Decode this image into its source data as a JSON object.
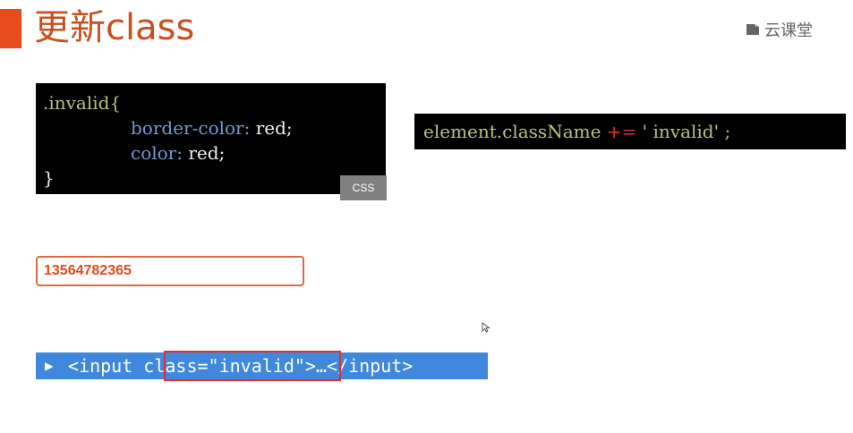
{
  "title": "更新class",
  "logo": {
    "text": "云课堂",
    "icon": "cloud-classroom-icon"
  },
  "css_code": {
    "lines": [
      {
        "selector": ".invalid{"
      },
      {
        "property": "border-color",
        "colon": ":",
        "value": " red;"
      },
      {
        "property": "color",
        "colon": ":",
        "value": " red;"
      },
      {
        "close": "}"
      }
    ],
    "tag": "CSS"
  },
  "js_code": {
    "object": "element.className",
    "operator": "+=",
    "string": "' invalid'",
    "end": " ;"
  },
  "input_demo": {
    "value": "13564782365"
  },
  "devtools": {
    "toggle": "▶",
    "before": "<input ",
    "attr": "class=\"invalid\"",
    "after": ">…</input>"
  },
  "colors": {
    "accent": "#e8491d",
    "title": "#c8501f",
    "devtools_bg": "#3f88dd",
    "highlight": "#e0302a"
  }
}
